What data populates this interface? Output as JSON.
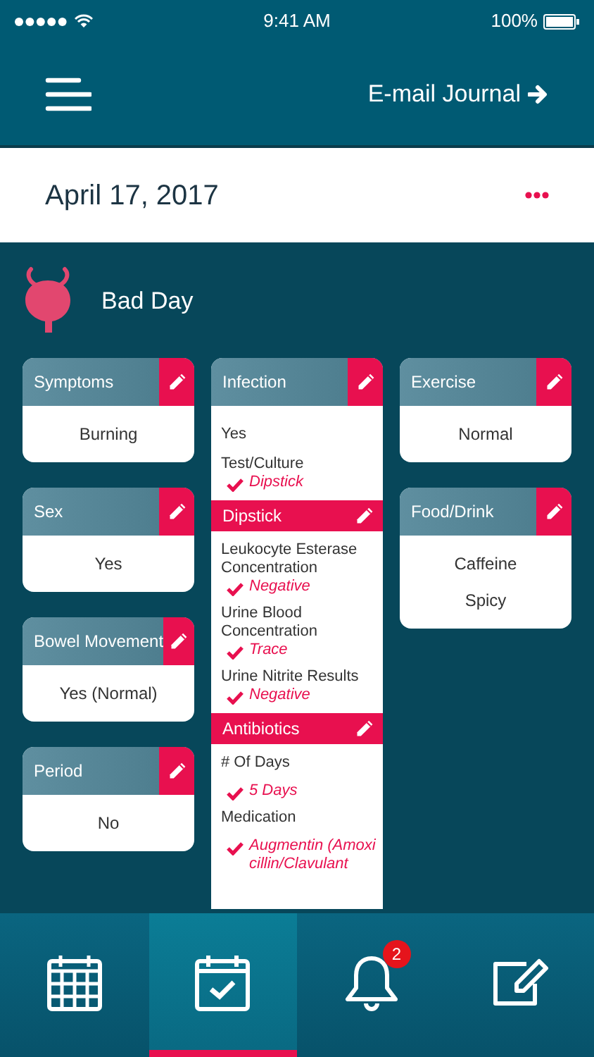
{
  "status_bar": {
    "time": "9:41 AM",
    "battery": "100%"
  },
  "header": {
    "action": "E-mail Journal"
  },
  "date_bar": {
    "date": "April 17, 2017"
  },
  "mood": {
    "label": "Bad Day"
  },
  "columns": [
    [
      {
        "kind": "simple",
        "title": "Symptoms",
        "values": [
          "Burning"
        ]
      },
      {
        "kind": "simple",
        "title": "Sex",
        "values": [
          "Yes"
        ]
      },
      {
        "kind": "simple",
        "title": "Bowel Movement",
        "values": [
          "Yes (Normal)"
        ]
      },
      {
        "kind": "simple",
        "title": "Period",
        "values": [
          "No"
        ]
      }
    ],
    [
      {
        "kind": "detail",
        "sections": [
          {
            "kind": "main",
            "title": "Infection",
            "items": [
              {
                "kind": "text",
                "text": "Yes"
              },
              {
                "kind": "answer",
                "label": "Test/Culture",
                "value": "Dipstick"
              }
            ]
          },
          {
            "kind": "sub",
            "title": "Dipstick",
            "items": [
              {
                "kind": "answer",
                "label": "Leukocyte Esterase Concentration",
                "value": "Negative"
              },
              {
                "kind": "answer",
                "label": "Urine Blood Concentration",
                "value": "Trace"
              },
              {
                "kind": "answer",
                "label": "Urine Nitrite Results",
                "value": "Negative"
              }
            ]
          },
          {
            "kind": "sub",
            "title": "Antibiotics",
            "items": [
              {
                "kind": "spaced",
                "label": "# Of Days",
                "value": "5 Days"
              },
              {
                "kind": "spaced",
                "label": "Medication",
                "value": "Augmentin (Amoxicillin/Clavulant"
              }
            ]
          }
        ]
      }
    ],
    [
      {
        "kind": "simple",
        "title": "Exercise",
        "values": [
          "Normal"
        ]
      },
      {
        "kind": "simple",
        "title": "Food/Drink",
        "values": [
          "Caffeine",
          "Spicy"
        ]
      }
    ]
  ],
  "tab_bar": [
    {
      "kind": "calendar",
      "selected": false
    },
    {
      "kind": "checklist",
      "selected": true
    },
    {
      "kind": "alerts",
      "selected": false,
      "badge": "2"
    },
    {
      "kind": "compose",
      "selected": false
    }
  ]
}
